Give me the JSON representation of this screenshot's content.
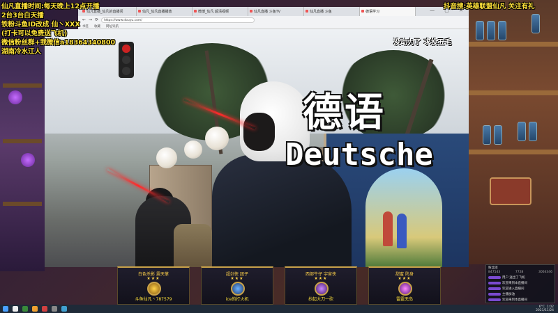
{
  "overlay_left": [
    "仙凡直播时间:每天晚上12点开播",
    "2台3台白天播",
    "铁粉斗鱼ID改成 仙丶XXX",
    "(打卡可以免费送飞机)",
    "微信粉丝群+我微信a18364340800",
    "湖南冷水江人"
  ],
  "overlay_right": "抖音搜:英雄联盟仙凡 关注有礼",
  "browser": {
    "tabs": [
      "仙凡直播_仙凡的直播间",
      "仙凡_仙凡直播播放",
      "微博_仙凡 超清视频",
      "仙凡直播 斗鱼TV",
      "仙凡直播 斗鱼",
      "德语学习"
    ],
    "window_controls": "— ▢ ✕",
    "address": "https://www.douyu.com/",
    "bookmarks": [
      "书签",
      "收藏",
      "网址导航"
    ]
  },
  "video": {
    "top_caption": "没动力了 求投五毛",
    "title_cn": "德语",
    "title_de": "Deutsche"
  },
  "dock": [
    {
      "title": "白色杀影 震天掌",
      "stars": "★★★",
      "name": "斗鱼仙凡丶787579"
    },
    {
      "title": "超剑侠 团子",
      "stars": "★★★",
      "name": "ice的打火机"
    },
    {
      "title": "西部牛仔 宇宙侠",
      "stars": "★★★",
      "name": "抄起大刀一砍"
    },
    {
      "title": "甜蜜 防身",
      "stars": "★★★",
      "name": "雷霆无岛"
    }
  ],
  "chat": {
    "header": "粉丝团",
    "stats": [
      "847543",
      "7728",
      "3004346"
    ],
    "lines": [
      "用户 送出了飞机",
      "欢迎来到本直播间",
      "欢迎进入直播间",
      "主播加油",
      "欢迎来到本直播间"
    ]
  },
  "taskbar": {
    "time": "1:02",
    "date": "2021/11/24",
    "weather": "6°C"
  },
  "colors": {
    "overlay_yellow": "#ffe23a",
    "dock_gold": "#c9a24a"
  }
}
